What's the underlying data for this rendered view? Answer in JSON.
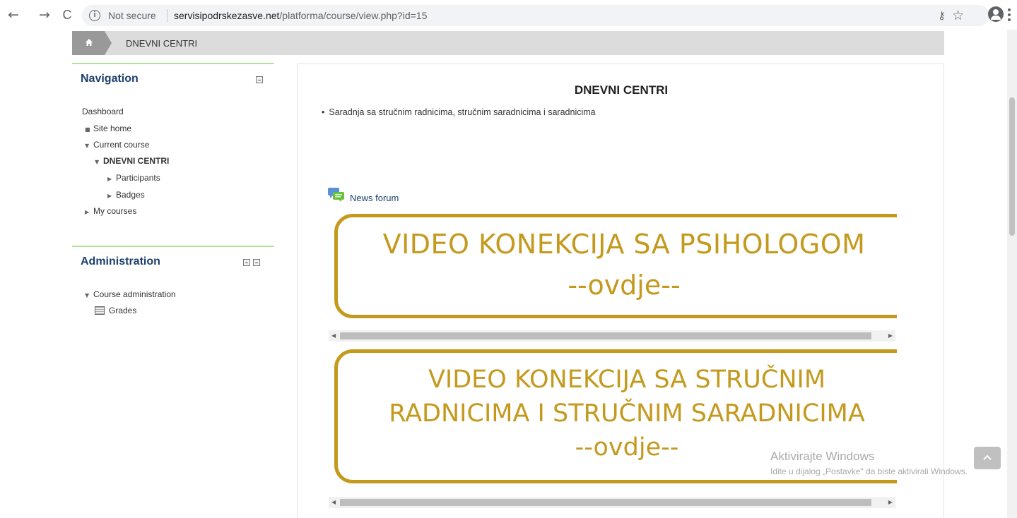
{
  "browser": {
    "back_glyph": "←",
    "forward_glyph": "→",
    "reload_glyph": "C",
    "info_glyph": "i",
    "security_label": "Not secure",
    "url_host": "servisipodrskezasve.net",
    "url_path": "/platforma/course/view.php?id=15",
    "key_glyph": "⚷",
    "star_glyph": "☆"
  },
  "breadcrumb": {
    "current": "DNEVNI CENTRI"
  },
  "navigation": {
    "title": "Navigation",
    "items": [
      {
        "label": "Dashboard",
        "marker": ""
      },
      {
        "label": "Site home",
        "marker": "■"
      },
      {
        "label": "Current course",
        "marker": "▼"
      },
      {
        "label": "DNEVNI CENTRI",
        "marker": "▼"
      },
      {
        "label": "Participants",
        "marker": "▶"
      },
      {
        "label": "Badges",
        "marker": "▶"
      },
      {
        "label": "My courses",
        "marker": "▶"
      }
    ]
  },
  "administration": {
    "title": "Administration",
    "items": [
      {
        "label": "Course administration",
        "marker": "▼"
      },
      {
        "label": "Grades",
        "marker": ""
      }
    ]
  },
  "course": {
    "title": "DNEVNI CENTRI",
    "summary": "Saradnja sa stručnim radnicima, stručnim saradnicima i saradnicima",
    "forum_link": "News forum"
  },
  "banners": [
    {
      "line1": "VIDEO KONEKCIJA SA PSIHOLOGOM",
      "line2": "--ovdje--"
    },
    {
      "line1": "VIDEO KONEKCIJA SA STRUČNIM",
      "line2": "RADNICIMA I STRUČNIM SARADNICIMA",
      "line3": "--ovdje--"
    }
  ],
  "scroll_arrows": {
    "left": "◀",
    "right": "▶"
  },
  "watermark": {
    "title": "Aktivirajte Windows",
    "subtitle": "Idite u dijalog „Postavke\" da biste aktivirali Windows."
  },
  "colors": {
    "banner_gold": "#c49a1e",
    "nav_title": "#1e3f6c",
    "block_accent": "#b6e19b"
  }
}
